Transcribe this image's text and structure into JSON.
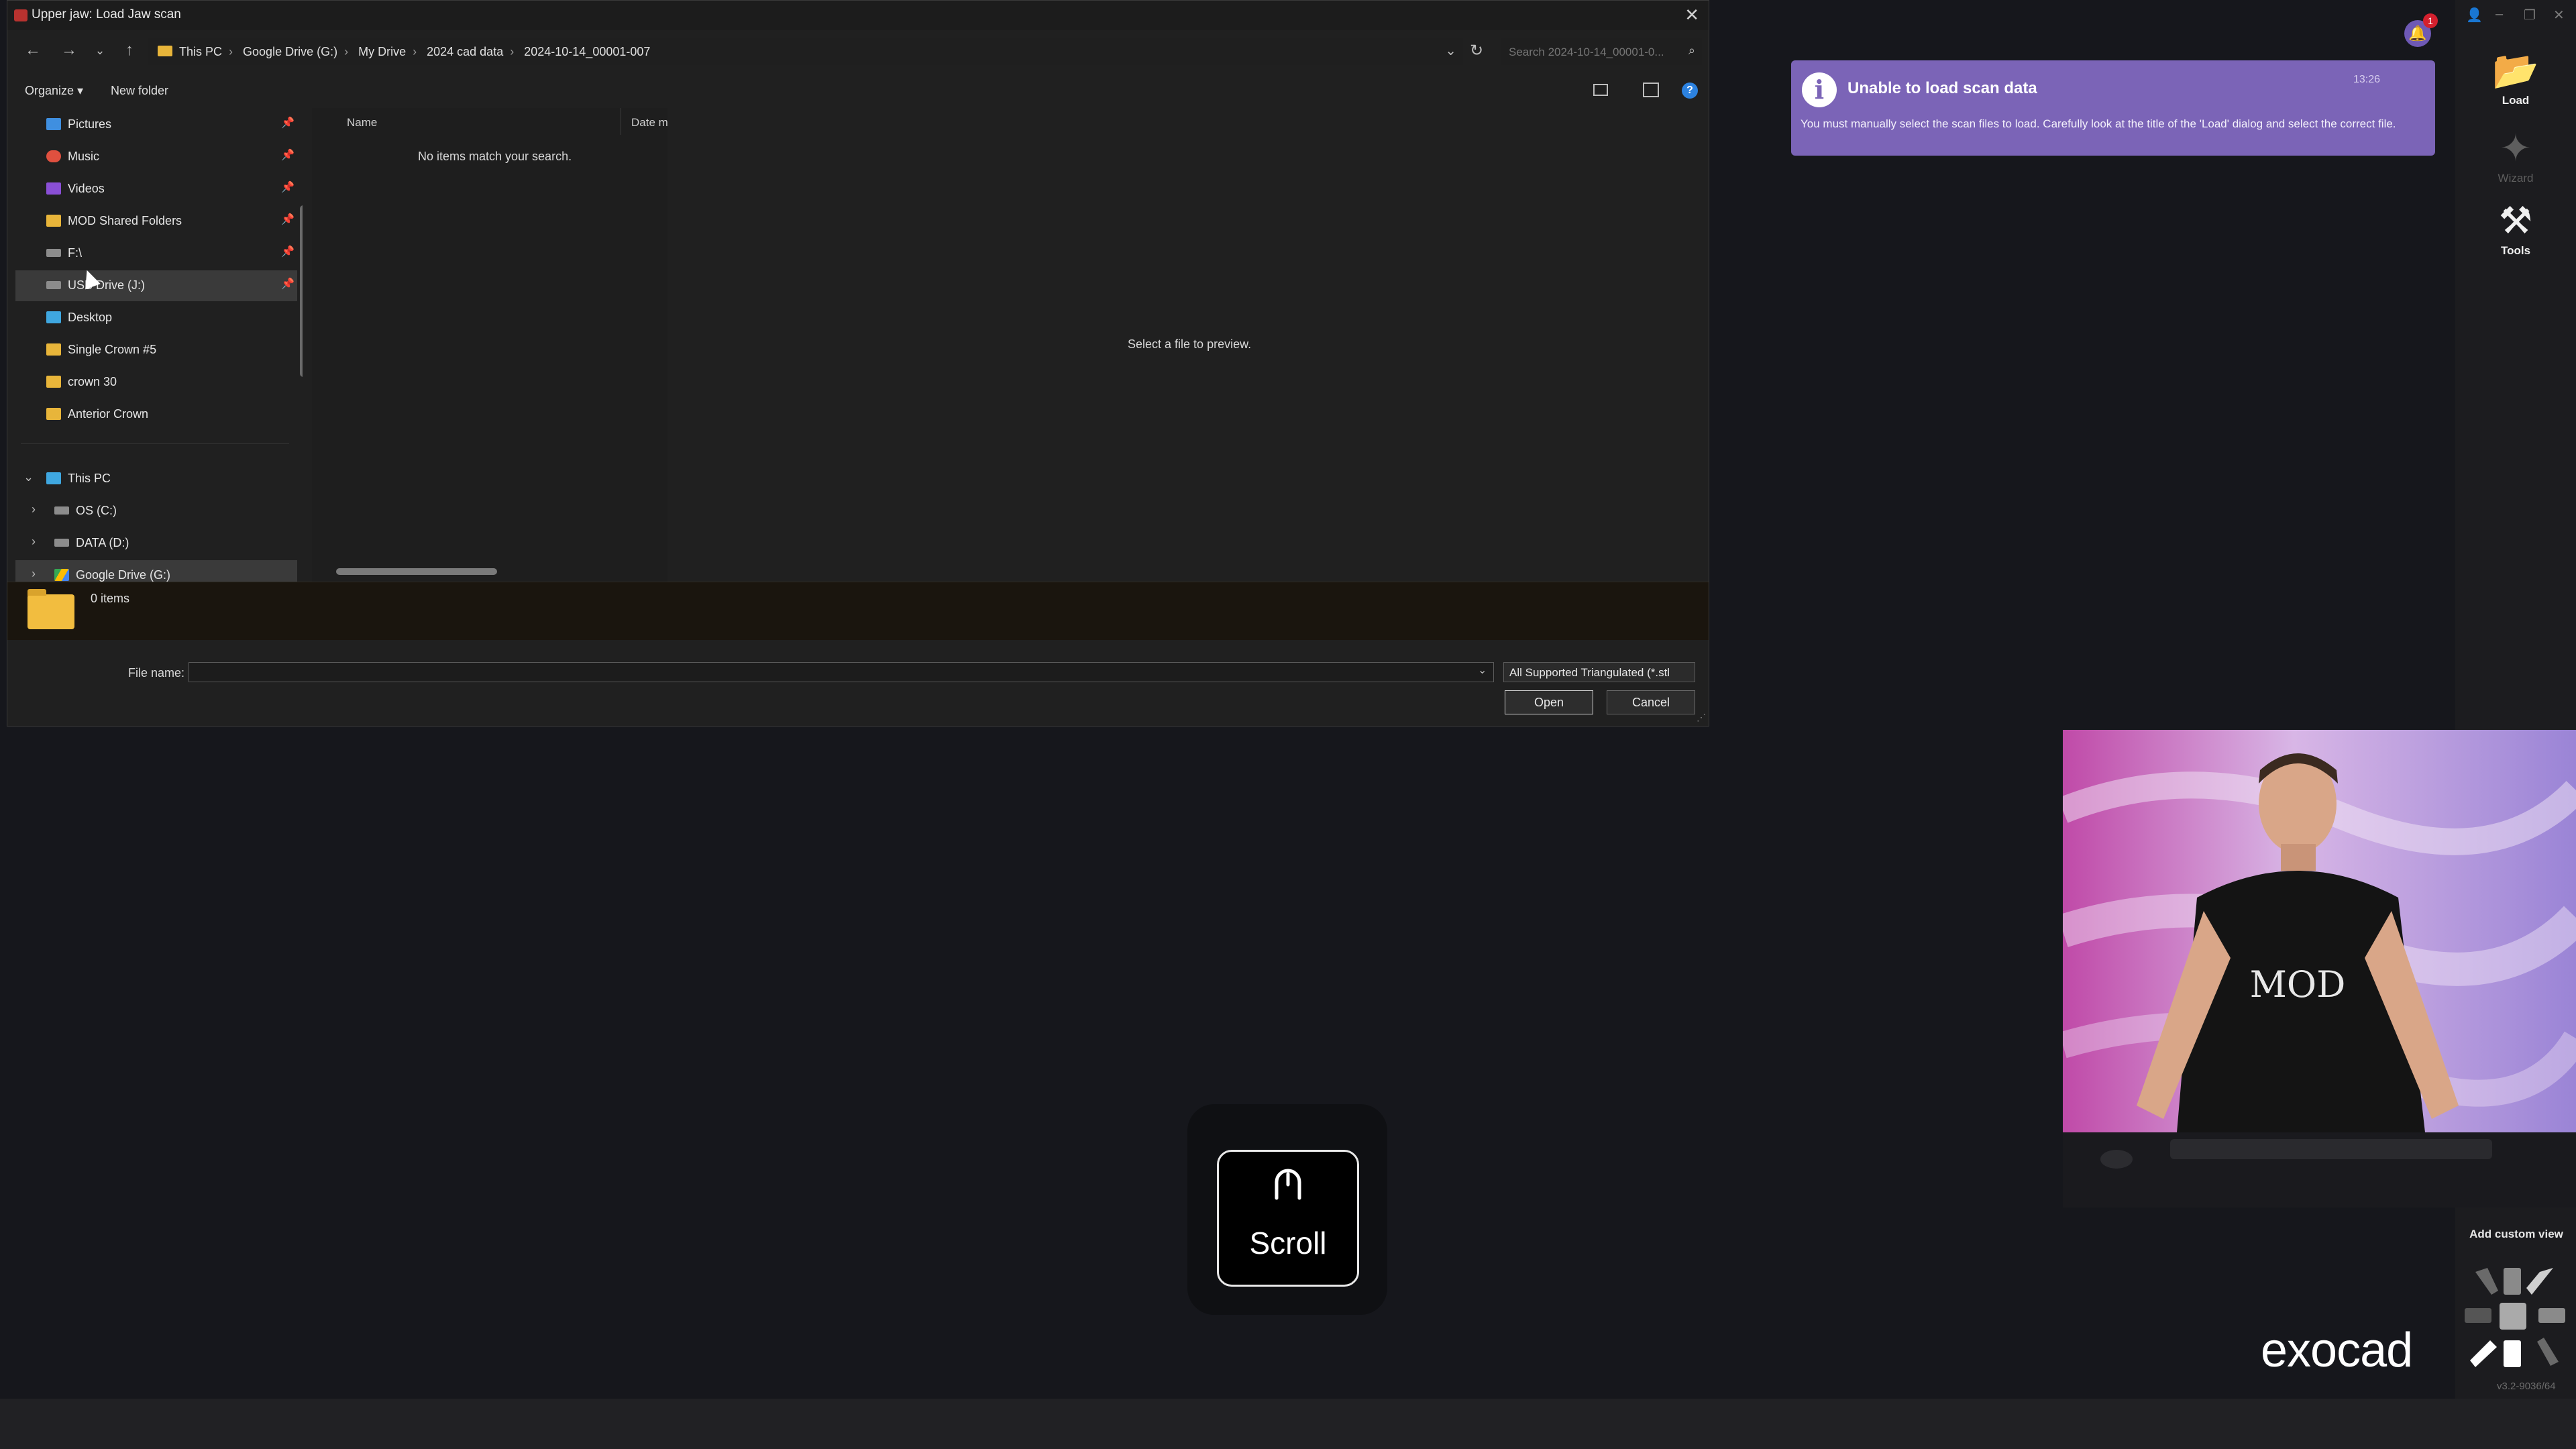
{
  "dialog": {
    "title": "Upper jaw: Load Jaw scan",
    "breadcrumbs": [
      "This PC",
      "Google Drive (G:)",
      "My Drive",
      "2024 cad data",
      "2024-10-14_00001-007"
    ],
    "search_placeholder": "Search 2024-10-14_00001-0...",
    "organize_label": "Organize ▾",
    "new_folder_label": "New folder",
    "sidebar": {
      "quick_access": [
        {
          "label": "Pictures",
          "icon": "pictures-icon",
          "color": "#3f8fe0",
          "pinned": true
        },
        {
          "label": "Music",
          "icon": "music-icon",
          "color": "#e0503f",
          "pinned": true
        },
        {
          "label": "Videos",
          "icon": "videos-icon",
          "color": "#8a4fd6",
          "pinned": true
        },
        {
          "label": "MOD Shared Folders",
          "icon": "folder-icon",
          "color": "#e8b53a",
          "pinned": true
        },
        {
          "label": "F:\\",
          "icon": "drive-icon",
          "color": "#9a9a9a",
          "pinned": true
        },
        {
          "label": "USB Drive (J:)",
          "icon": "usb-drive-icon",
          "color": "#9a9a9a",
          "pinned": true
        },
        {
          "label": "Desktop",
          "icon": "desktop-icon",
          "color": "#3fa7e0",
          "pinned": false
        },
        {
          "label": "Single Crown #5",
          "icon": "folder-icon",
          "color": "#e8b53a",
          "pinned": false
        },
        {
          "label": "crown 30",
          "icon": "folder-icon",
          "color": "#e8b53a",
          "pinned": false
        },
        {
          "label": "Anterior Crown",
          "icon": "folder-icon",
          "color": "#e8b53a",
          "pinned": false
        }
      ],
      "this_pc": {
        "label": "This PC",
        "children": [
          {
            "label": "OS (C:)",
            "icon": "drive-icon"
          },
          {
            "label": "DATA (D:)",
            "icon": "drive-icon"
          },
          {
            "label": "Google Drive (G:)",
            "icon": "google-drive-icon"
          }
        ]
      }
    },
    "columns": {
      "name": "Name",
      "date": "Date m"
    },
    "empty_message": "No items match your search.",
    "preview_message": "Select a file to preview.",
    "items_count": "0 items",
    "file_name_label": "File name:",
    "file_name_value": "",
    "file_type": "All Supported Triangulated (*.stl",
    "open_label": "Open",
    "cancel_label": "Cancel"
  },
  "notification": {
    "title": "Unable to load scan data",
    "time": "13:26",
    "body": "You must manually select the scan files to load. Carefully look at the title of the 'Load' dialog and select the correct file."
  },
  "right_panel": {
    "bell_badge": "1",
    "load_label": "Load",
    "wizard_label": "Wizard",
    "tools_label": "Tools",
    "custom_view_label": "Add custom view",
    "version": "v3.2-9036/64",
    "brand": "exocad"
  },
  "webcam": {
    "shirt_text": "MOD"
  },
  "scroll_overlay": {
    "label": "Scroll"
  },
  "colors": {
    "accent": "#7b64b7",
    "bell": "#6e59b5",
    "badge": "#d4202e",
    "folder": "#e8b53a"
  }
}
